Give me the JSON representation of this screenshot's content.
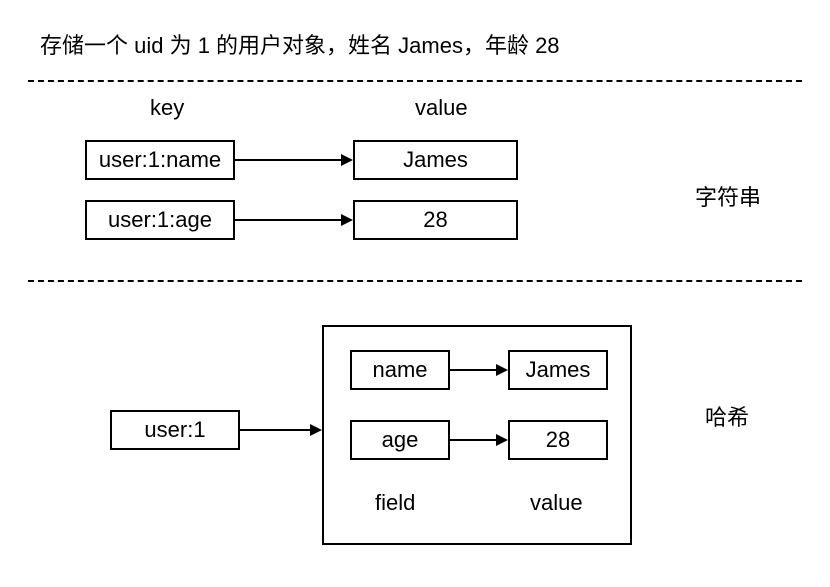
{
  "title": "存储一个 uid 为 1 的用户对象，姓名 James，年龄 28",
  "headers": {
    "key": "key",
    "value": "value"
  },
  "string_section": {
    "label": "字符串",
    "rows": [
      {
        "key": "user:1:name",
        "value": "James"
      },
      {
        "key": "user:1:age",
        "value": "28"
      }
    ]
  },
  "hash_section": {
    "label": "哈希",
    "key": "user:1",
    "field_label": "field",
    "value_label": "value",
    "rows": [
      {
        "field": "name",
        "value": "James"
      },
      {
        "field": "age",
        "value": "28"
      }
    ]
  }
}
